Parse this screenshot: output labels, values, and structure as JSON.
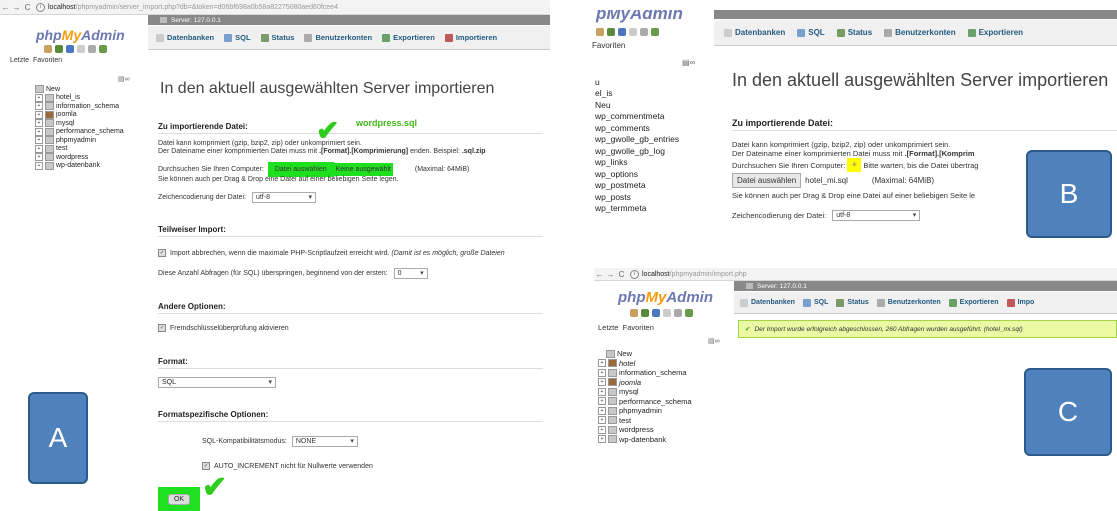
{
  "colors": {
    "accent": "#235a81",
    "logo_php": "#6c78af",
    "logo_my": "#f89c0e",
    "highlight_green": "#1fe01f",
    "highlight_yellow": "#ffff00",
    "label_blue": "#4f81bd",
    "check_green": "#2ecc1d",
    "success_bg": "#ebf8a4"
  },
  "panel_a": {
    "url_host": "localhost",
    "url_rest": "/phpmyadmin/server_import.php?db=&token=d06bf698a0b58a82275080aed60fcee4",
    "logo_php": "php",
    "logo_my": "My",
    "logo_admin": "Admin",
    "side_tabs": [
      "Letzte",
      "Favoriten"
    ],
    "tree": [
      "New",
      "hotel_is",
      "information_schema",
      "joomla",
      "mysql",
      "performance_schema",
      "phpmyadmin",
      "test",
      "wordpress",
      "wp-datenbank"
    ],
    "server": "Server: 127.0.0.1",
    "tabs": [
      "Datenbanken",
      "SQL",
      "Status",
      "Benutzerkonten",
      "Exportieren",
      "Importieren"
    ],
    "title": "In den aktuell ausgewählten Server importieren",
    "sec_file": "Zu importierende Datei:",
    "file_line1": "Datei kann komprimiert (gzip, bzip2, zip) oder unkomprimiert sein.",
    "file_line2a": "Der Dateiname einer komprimierten Datei muss mit ",
    "file_line2b": ".[Format].[Komprimierung]",
    "file_line2c": " enden. Beispiel: ",
    "file_line2d": ".sql.zip",
    "browse_label": "Durchsuchen Sie Ihren Computer:",
    "browse_button": "Datei auswählen",
    "no_file": "Keine ausgewählt",
    "max_size": "(Maximal: 64MiB)",
    "drag_drop": "Sie können auch per Drag & Drop eine Datei auf einer beliebigen Seite legen.",
    "charset_label": "Zeichencodierung der Datei:",
    "charset_value": "utf-8",
    "annotation_file": "wordpress.sql",
    "sec_partial": "Teilweiser Import:",
    "partial_check": "Import abbrechen, wenn die maximale PHP-Scriptlaufzeit erreicht wird.",
    "partial_note": "(Damit ist es möglich, große Dateien",
    "skip_label": "Diese Anzahl Abfragen (für SQL) überspringen, beginnend von der ersten:",
    "skip_value": "0",
    "sec_other": "Andere Optionen:",
    "fk_check": "Fremdschlüsselüberprüfung aktivieren",
    "sec_format": "Format:",
    "format_value": "SQL",
    "sec_format_opts": "Formatspezifische Optionen:",
    "compat_label": "SQL-Kompatibilitätsmodus:",
    "compat_value": "NONE",
    "auto_inc": "AUTO_INCREMENT nicht für Nullwerte verwenden",
    "ok_button": "OK",
    "label": "A"
  },
  "panel_b": {
    "logo": "pMyAdmin",
    "side_tabs": "Favoriten",
    "tree": [
      "u",
      "el_is",
      "Neu",
      "wp_commentmeta",
      "wp_comments",
      "wp_gwolle_gb_entries",
      "wp_gwolle_gb_log",
      "wp_links",
      "wp_options",
      "wp_postmeta",
      "wp_posts",
      "wp_termmeta"
    ],
    "tabs": [
      "Datenbanken",
      "SQL",
      "Status",
      "Benutzerkonten",
      "Exportieren"
    ],
    "title": "In den aktuell ausgewählten Server importieren",
    "sec_file": "Zu importierende Datei:",
    "file_line1": "Datei kann komprimiert (gzip, bzip2, zip) oder unkomprimiert sein.",
    "file_line2a": "Der Dateiname einer komprimierten Datei muss mit ",
    "file_line2b": ".[Format].[Komprim",
    "browse_label": "Durchsuchen Sie Ihren Computer:",
    "wait_text": "Bitte warten, bis die Datei übertrag",
    "browse_button": "Datei auswählen",
    "file_name": "hotel_mi.sql",
    "max_size": "(Maximal: 64MiB)",
    "drag_drop": "Sie können auch per Drag & Drop eine Datei auf einer beliebigen Seite le",
    "charset_label": "Zeichencodierung der Datei:",
    "charset_value": "utf-8",
    "label": "B"
  },
  "panel_c": {
    "url_host": "localhost",
    "url_rest": "/phpmyadmin/import.php",
    "logo_php": "php",
    "logo_my": "My",
    "logo_admin": "Admin",
    "side_tabs": [
      "Letzte",
      "Favoriten"
    ],
    "tree": [
      "New",
      "hotel",
      "information_schema",
      "joomla",
      "mysql",
      "performance_schema",
      "phpmyadmin",
      "test",
      "wordpress",
      "wp-datenbank"
    ],
    "server": "Server: 127.0.0.1",
    "tabs": [
      "Datenbanken",
      "SQL",
      "Status",
      "Benutzerkonten",
      "Exportieren",
      "Impo"
    ],
    "success": "Der Import wurde erfolgreich abgeschlossen, 260 Abfragen wurden ausgeführt. (hotel_mi.sql)",
    "label": "C"
  }
}
